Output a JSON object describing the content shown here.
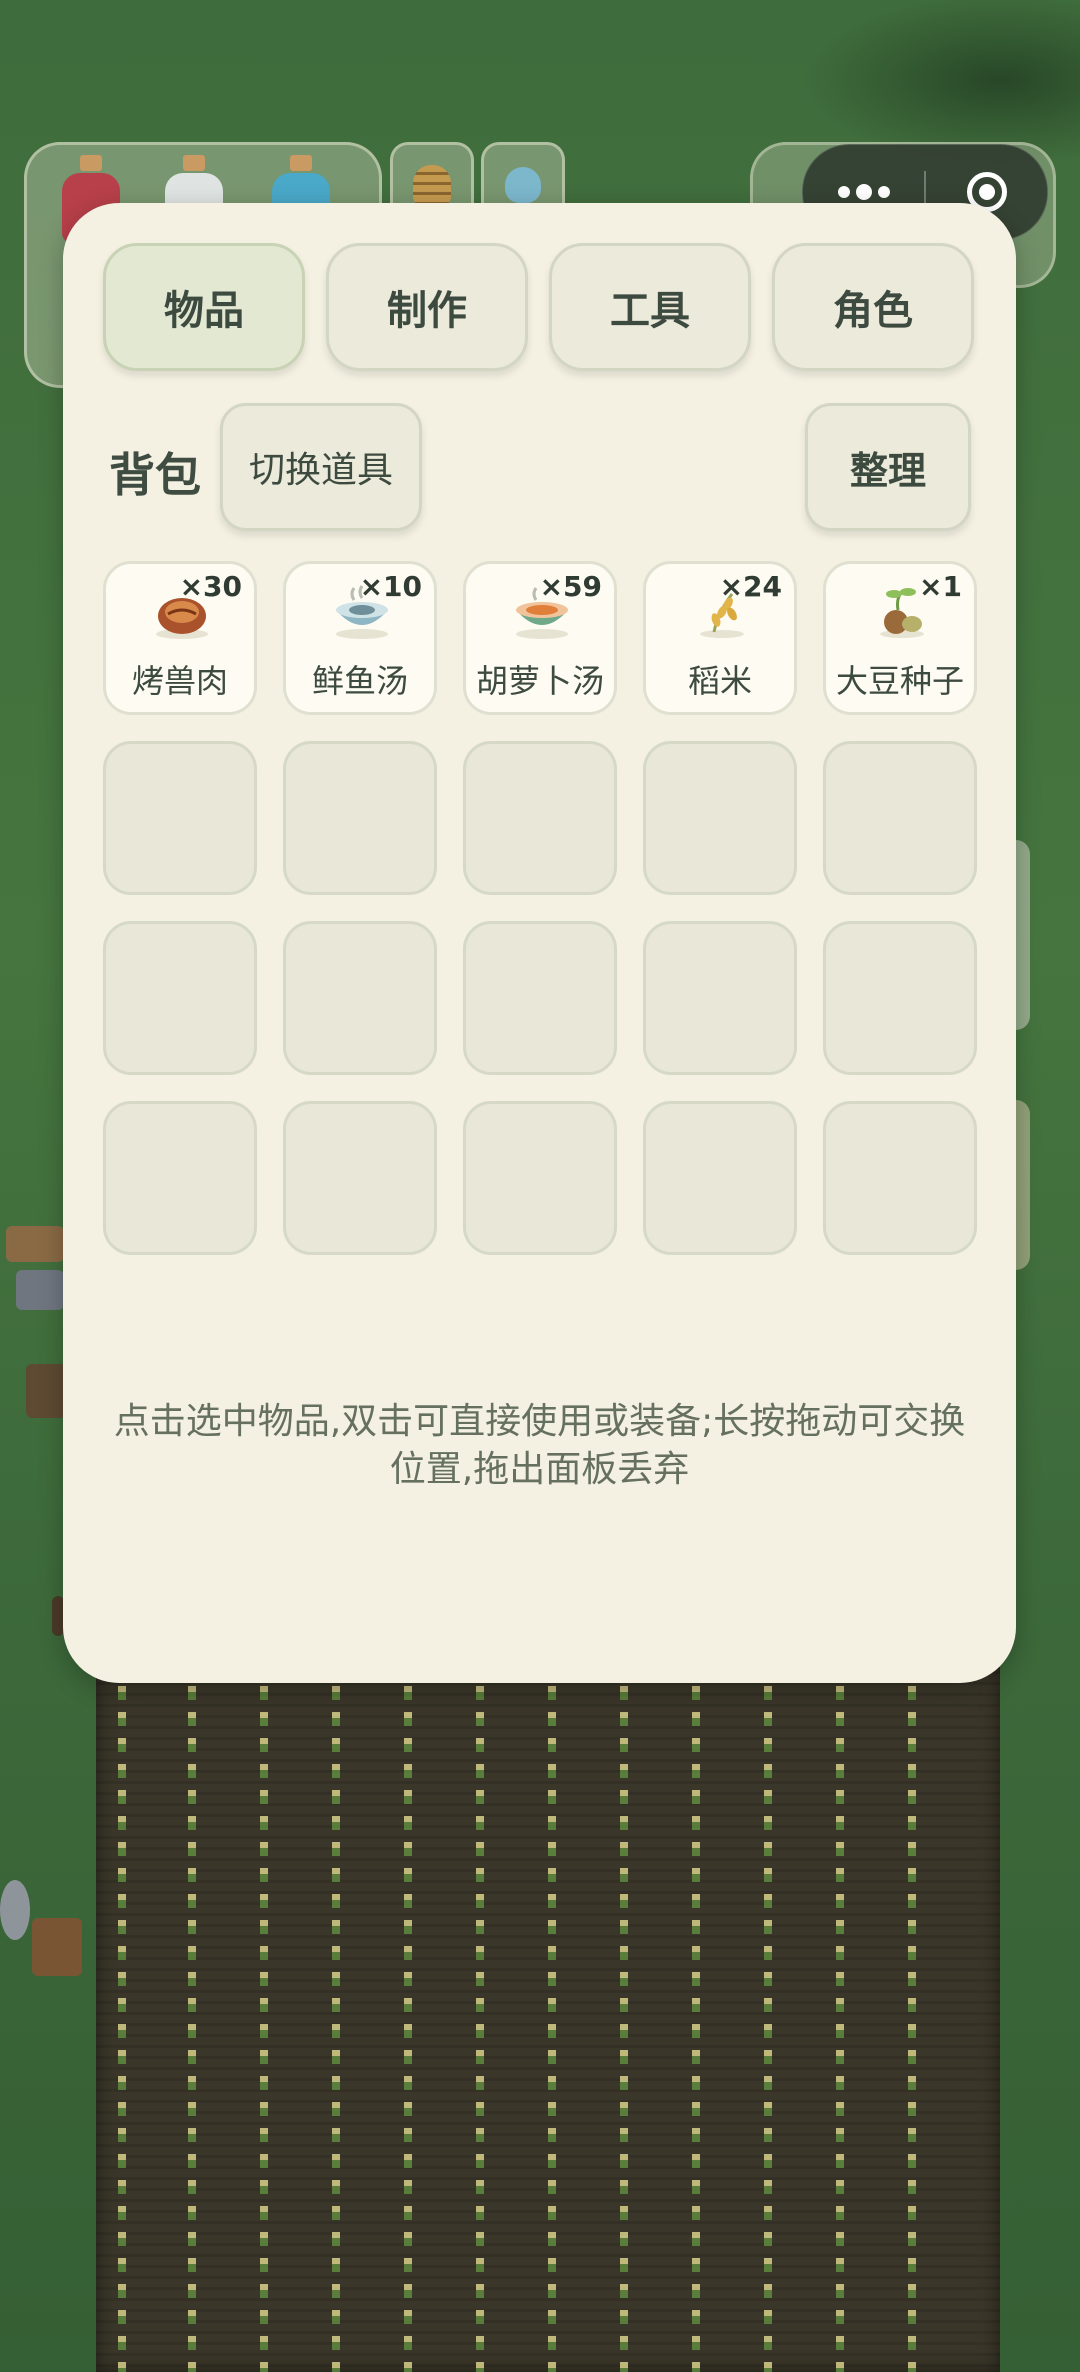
{
  "panel": {
    "tabs": [
      {
        "label": "物品",
        "active": true
      },
      {
        "label": "制作",
        "active": false
      },
      {
        "label": "工具",
        "active": false
      },
      {
        "label": "角色",
        "active": false
      }
    ],
    "bag_title": "背包",
    "switch_button": "切换道具",
    "sort_button": "整理",
    "items": [
      {
        "name": "烤兽肉",
        "qty": "×30",
        "icon": "roast-meat-icon"
      },
      {
        "name": "鲜鱼汤",
        "qty": "×10",
        "icon": "fish-soup-icon"
      },
      {
        "name": "胡萝卜汤",
        "qty": "×59",
        "icon": "carrot-soup-icon"
      },
      {
        "name": "稻米",
        "qty": "×24",
        "icon": "rice-icon"
      },
      {
        "name": "大豆种子",
        "qty": "×1",
        "icon": "soybean-seed-icon"
      }
    ],
    "hint": "点击选中物品,双击可直接使用或装备;长按拖动可交换位置,拖出面板丢弃"
  },
  "hud": {
    "potions": [
      "red-potion-icon",
      "white-potion-icon",
      "blue-potion-icon"
    ],
    "beehive_count": "1"
  },
  "colors": {
    "panel_bg": "#f4f1e2",
    "active_tab": "#e3e8d2",
    "text_dark": "#3d4a40",
    "hint_text": "#66705f"
  }
}
